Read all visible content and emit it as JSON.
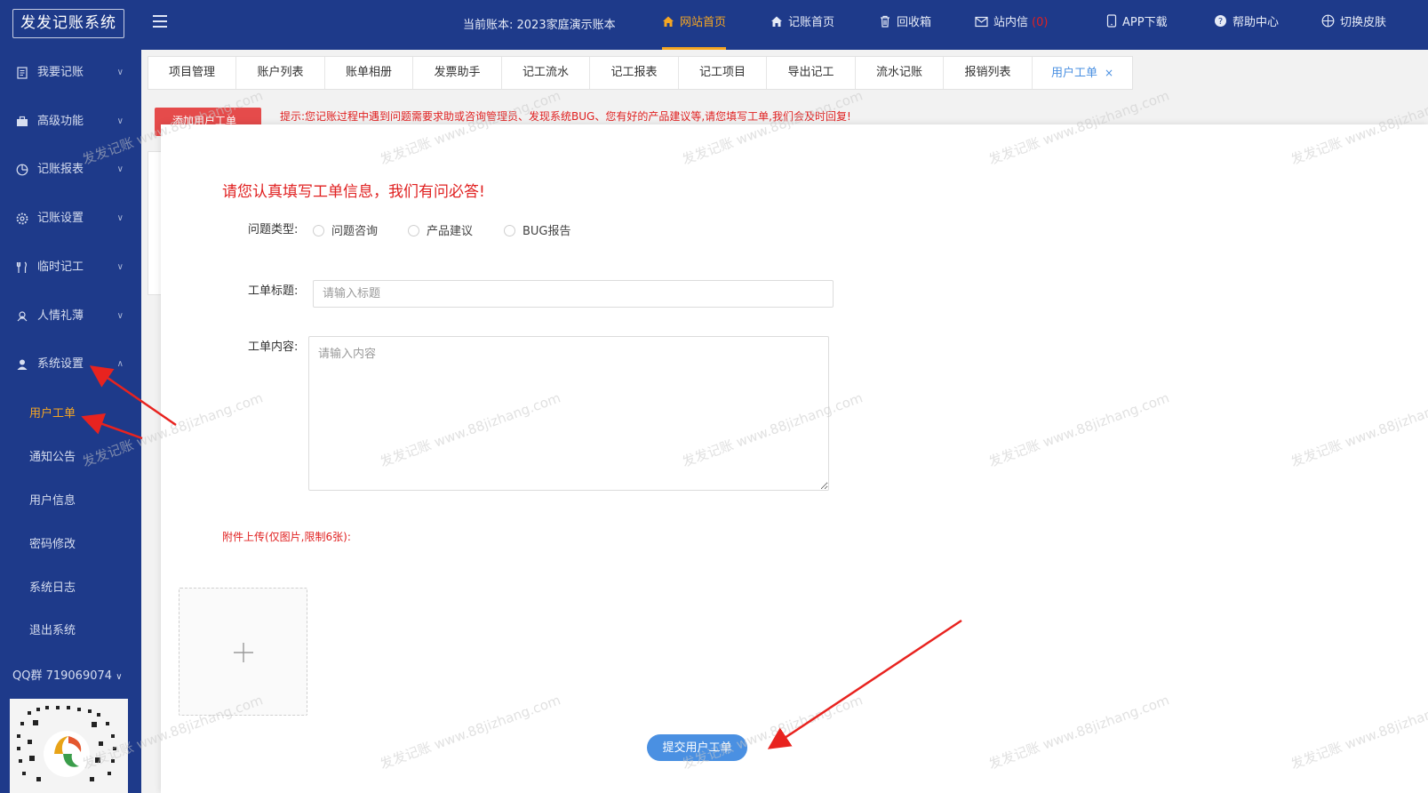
{
  "app": {
    "logo": "发发记账系统"
  },
  "header": {
    "account_label": "当前账本: 2023家庭演示账本",
    "nav": [
      {
        "label": "网站首页",
        "icon": "home-icon",
        "active": true
      },
      {
        "label": "记账首页",
        "icon": "home-icon"
      },
      {
        "label": "回收箱",
        "icon": "trash-icon"
      },
      {
        "label": "站内信",
        "icon": "mail-icon",
        "count": "(0)"
      },
      {
        "label": "APP下载",
        "icon": "phone-icon"
      },
      {
        "label": "帮助中心",
        "icon": "help-icon"
      },
      {
        "label": "切换皮肤",
        "icon": "palette-icon"
      }
    ]
  },
  "sidebar": {
    "groups": [
      {
        "label": "我要记账",
        "icon": "ledger-icon"
      },
      {
        "label": "高级功能",
        "icon": "briefcase-icon"
      },
      {
        "label": "记账报表",
        "icon": "pie-chart-icon"
      },
      {
        "label": "记账设置",
        "icon": "gear-icon"
      },
      {
        "label": "临时记工",
        "icon": "utensils-icon"
      },
      {
        "label": "人情礼薄",
        "icon": "gift-icon"
      },
      {
        "label": "系统设置",
        "icon": "user-icon",
        "expanded": true
      }
    ],
    "sub_items": [
      {
        "label": "用户工单",
        "active": true
      },
      {
        "label": "通知公告"
      },
      {
        "label": "用户信息"
      },
      {
        "label": "密码修改"
      },
      {
        "label": "系统日志"
      },
      {
        "label": "退出系统"
      }
    ],
    "qq": "QQ群 719069074"
  },
  "tabs": [
    {
      "label": "项目管理"
    },
    {
      "label": "账户列表"
    },
    {
      "label": "账单相册"
    },
    {
      "label": "发票助手"
    },
    {
      "label": "记工流水"
    },
    {
      "label": "记工报表"
    },
    {
      "label": "记工项目"
    },
    {
      "label": "导出记工"
    },
    {
      "label": "流水记账"
    },
    {
      "label": "报销列表"
    },
    {
      "label": "用户工单",
      "active": true,
      "close": "×"
    }
  ],
  "page": {
    "add_button": "添加用户工单",
    "hint": "提示:您记账过程中遇到问题需要求助或咨询管理员、发现系统BUG、您有好的产品建议等,请您填写工单,我们会及时回复!"
  },
  "modal": {
    "title": "请您认真填写工单信息，我们有问必答!",
    "type_label": "问题类型:",
    "type_options": [
      "问题咨询",
      "产品建议",
      "BUG报告"
    ],
    "title_label": "工单标题:",
    "title_placeholder": "请输入标题",
    "content_label": "工单内容:",
    "content_placeholder": "请输入内容",
    "attach_label": "附件上传(仅图片,限制6张):",
    "submit_label": "提交用户工单"
  },
  "watermark": "发发记账 www.88jizhang.com",
  "colors": {
    "primary_nav": "#1e3a8a",
    "accent": "#f5a623",
    "alert": "#e02020",
    "button": "#4a90e2"
  }
}
